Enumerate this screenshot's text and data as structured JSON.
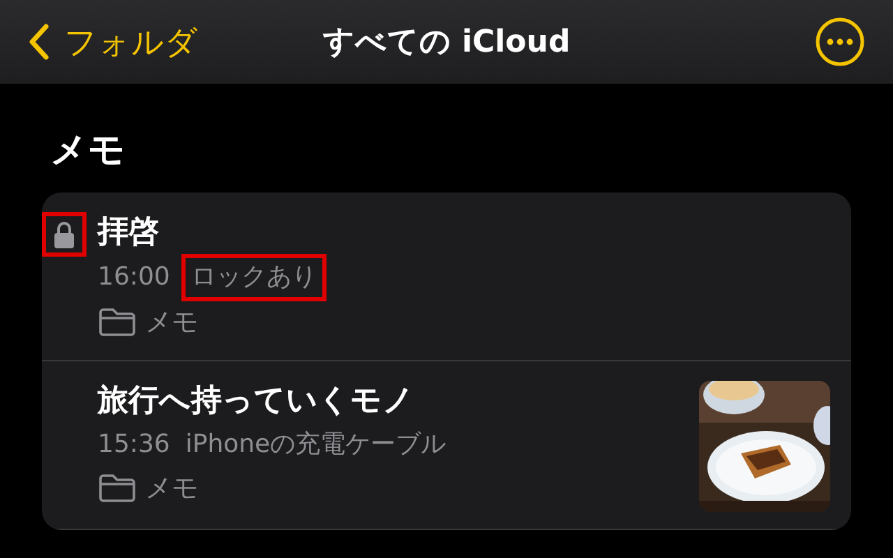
{
  "nav": {
    "back_label": "フォルダ",
    "title": "すべての iCloud"
  },
  "section_title": "メモ",
  "notes": [
    {
      "title": "拝啓",
      "locked": true,
      "lock_highlighted": true,
      "time": "16:00",
      "preview": "ロックあり",
      "preview_highlighted": true,
      "folder": "メモ",
      "has_picture": false
    },
    {
      "title": "旅行へ持っていくモノ",
      "locked": false,
      "lock_highlighted": false,
      "time": "15:36",
      "preview": "iPhoneの充電ケーブル",
      "preview_highlighted": false,
      "folder": "メモ",
      "has_picture": true
    }
  ]
}
